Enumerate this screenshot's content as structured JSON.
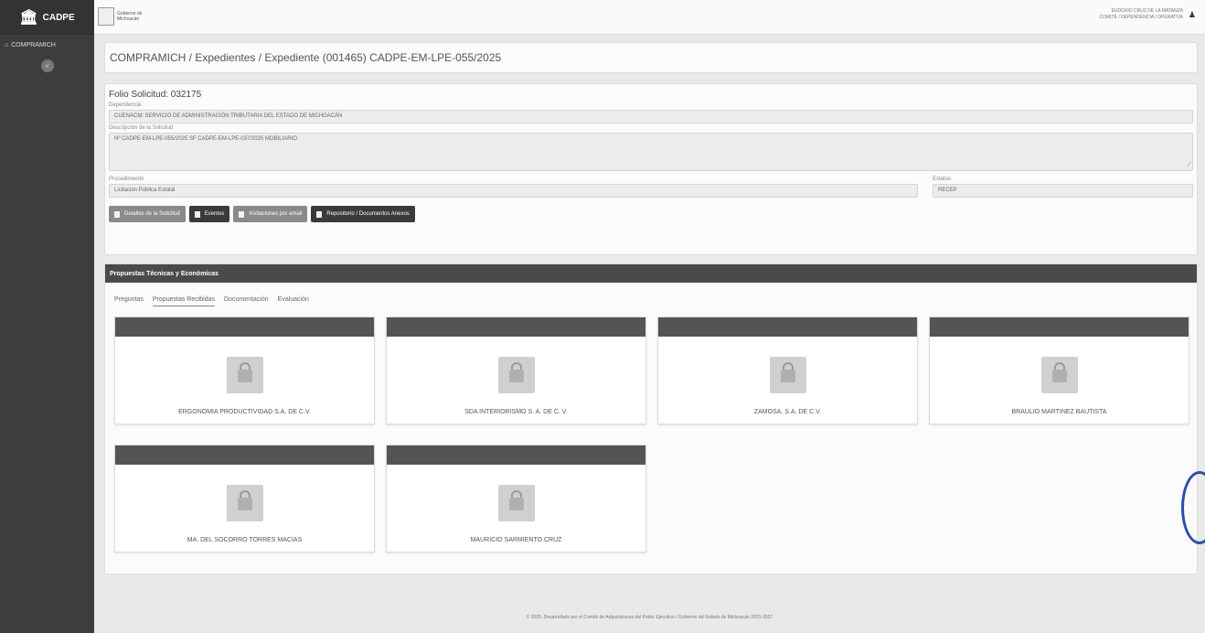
{
  "sidebar": {
    "brand": "CADPE",
    "nav_label": "COMPRAMICH",
    "collapse_icon": "<"
  },
  "topbar": {
    "logo_text": "Gobierno de Michoacán",
    "user_line1": "EUDOXIO CRUZ DE LA MATANZA",
    "user_line2": "COMITÉ / DEPENDENCIA / OPERATIVA"
  },
  "breadcrumb": "COMPRAMICH / Expedientes / Expediente (001465) CADPE-EM-LPE-055/2025",
  "form": {
    "folio": "Folio Solicitud: 032175",
    "dependencia_label": "Dependencia",
    "dependencia_value": "CUENACM: SERVICIO DE ADMINISTRACIÓN TRIBUTARIA DEL ESTADO DE MICHOACÁN",
    "descripcion_label": "Descripción de la Solicitud",
    "descripcion_value": "Nº CADPE-EM-LPE-055/2025 SF CADPE-EM-LPE-037/2025 MOBILIARIO.",
    "procedimiento_label": "Procedimiento",
    "procedimiento_value": "Licitación Pública Estatal",
    "estatus_label": "Estatus",
    "estatus_value": "RECEP"
  },
  "buttons": [
    {
      "label": "Detalles de la Solicitud",
      "style": "grey"
    },
    {
      "label": "Eventos",
      "style": "dark"
    },
    {
      "label": "Invitaciones por email",
      "style": "grey"
    },
    {
      "label": "Repositorio / Documentos Anexos",
      "style": "dark"
    }
  ],
  "proposals": {
    "header": "Propuestas Técnicas y Económicas",
    "tabs": [
      "Preguntas",
      "Propuestas Recibidas",
      "Documentación",
      "Evaluación"
    ],
    "active_tab": 1,
    "cards": [
      {
        "name": "ERGONOMIA PRODUCTIVIDAD S.A. DE C.V."
      },
      {
        "name": "SDA INTERIORISMO S. A. DE C. V."
      },
      {
        "name": "ZAMOSA, S.A. DE C.V."
      },
      {
        "name": "BRAULIO MARTINEZ BAUTISTA"
      },
      {
        "name": "MA. DEL SOCORRO TORRES MACIAS"
      },
      {
        "name": "MAURICIO SARMIENTO CRUZ"
      }
    ]
  },
  "footer": "© 2025. Desarrollado por el Comité de Adquisiciones del Poder Ejecutivo / Gobierno del Estado de Michoacán 2021-2027"
}
